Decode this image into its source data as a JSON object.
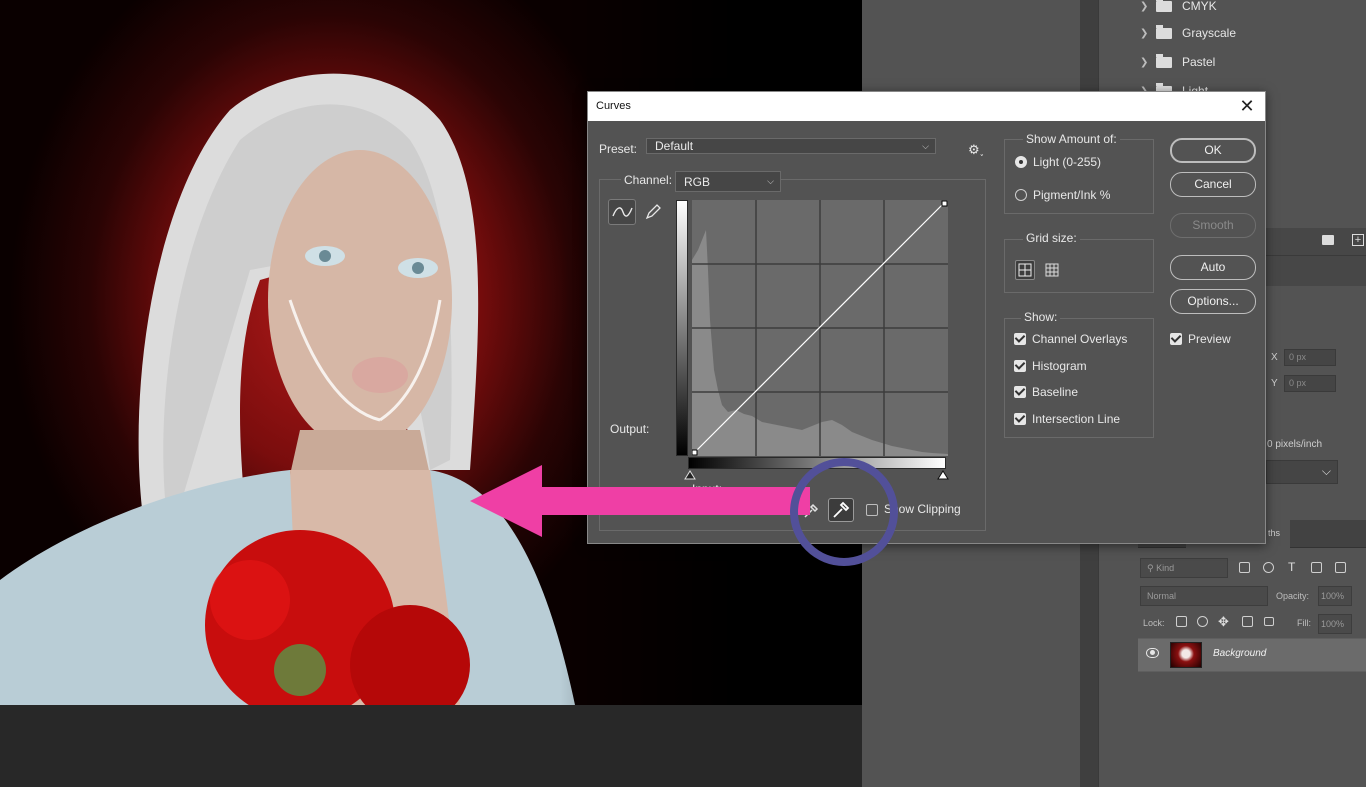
{
  "dialog": {
    "title": "Curves",
    "close_glyph": "✕",
    "preset_label": "Preset:",
    "preset_value": "Default",
    "channel_label": "Channel:",
    "channel_value": "RGB",
    "output_label": "Output:",
    "input_label": "Input:",
    "show_clipping_label": "Show Clipping",
    "show_amount": {
      "title": "Show Amount of:",
      "light": "Light  (0-255)",
      "pigment": "Pigment/Ink %"
    },
    "grid_size_label": "Grid size:",
    "show": {
      "title": "Show:",
      "items": [
        "Channel Overlays",
        "Histogram",
        "Baseline",
        "Intersection Line"
      ]
    },
    "buttons": {
      "ok": "OK",
      "cancel": "Cancel",
      "smooth": "Smooth",
      "auto": "Auto",
      "options": "Options..."
    },
    "preview_label": "Preview"
  },
  "folders": [
    "CMYK",
    "Grayscale",
    "Pastel",
    "Light"
  ],
  "properties": {
    "x_label": "X",
    "y_label": "Y",
    "x_value": "0 px",
    "y_value": "0 px",
    "resolution_text": "0 pixels/inch"
  },
  "layers": {
    "tab_text": "ths",
    "kind_placeholder": "Kind",
    "blend_mode": "Normal",
    "opacity_label": "Opacity:",
    "opacity_value": "100%",
    "lock_label": "Lock:",
    "fill_label": "Fill:",
    "fill_value": "100%",
    "layer_name": "Background"
  },
  "colors": {
    "dialog_bg": "#535353",
    "annotation_arrow": "#ef3fa5",
    "annotation_circle": "#525099"
  }
}
